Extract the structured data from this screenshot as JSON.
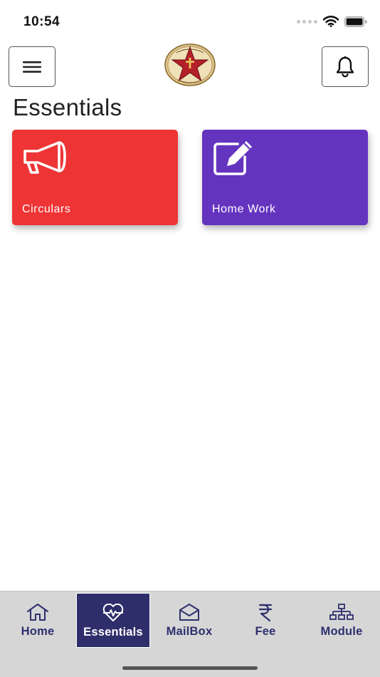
{
  "status_bar": {
    "time": "10:54"
  },
  "header": {
    "menu_icon": "hamburger-menu-icon",
    "notification_icon": "bell-icon",
    "logo": "school-crest-logo"
  },
  "page": {
    "title": "Essentials"
  },
  "cards": [
    {
      "label": "Circulars",
      "icon": "megaphone-icon",
      "color": "#ee3434"
    },
    {
      "label": "Home Work",
      "icon": "edit-icon",
      "color": "#6534bf"
    }
  ],
  "bottom_nav": {
    "active_color": "#2e2e6b",
    "items": [
      {
        "label": "Home",
        "icon": "home-icon",
        "active": false
      },
      {
        "label": "Essentials",
        "icon": "heartbeat-icon",
        "active": true
      },
      {
        "label": "MailBox",
        "icon": "envelope-icon",
        "active": false
      },
      {
        "label": "Fee",
        "icon": "rupee-icon",
        "active": false
      },
      {
        "label": "Module",
        "icon": "sitemap-icon",
        "active": false
      }
    ]
  }
}
